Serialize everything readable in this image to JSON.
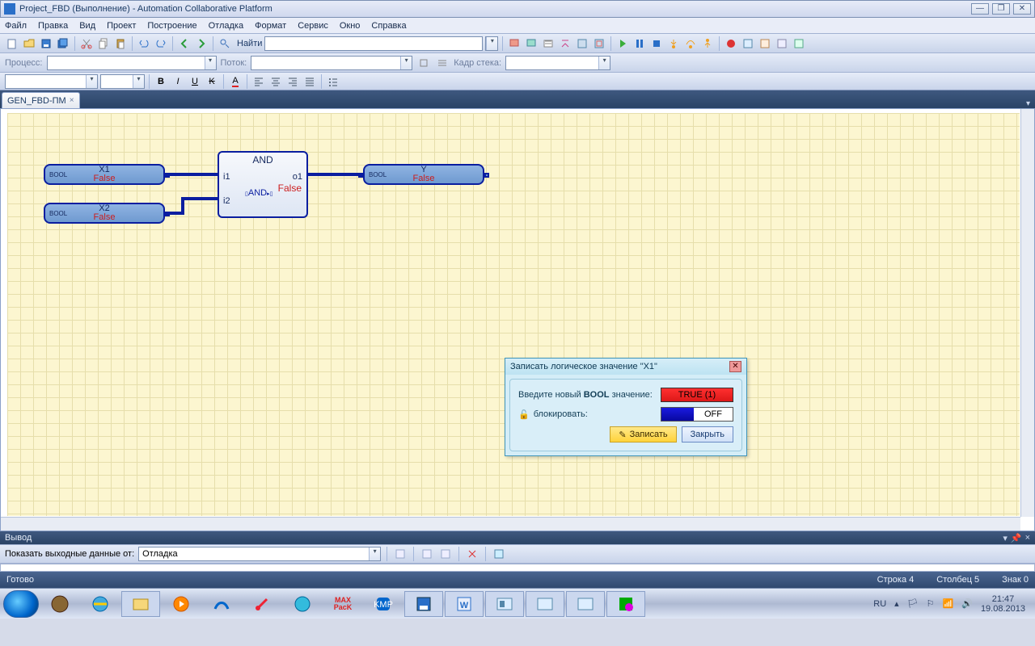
{
  "title": "Project_FBD (Выполнение) - Automation Collaborative Platform",
  "menu": [
    "Файл",
    "Правка",
    "Вид",
    "Проект",
    "Построение",
    "Отладка",
    "Формат",
    "Сервис",
    "Окно",
    "Справка"
  ],
  "find_label": "Найти",
  "process_label": "Процесс:",
  "thread_label": "Поток:",
  "stack_label": "Кадр стека:",
  "tab": "GEN_FBD-ПМ",
  "nodes": {
    "x1": {
      "name": "X1",
      "val": "False",
      "type": "BOOL"
    },
    "x2": {
      "name": "X2",
      "val": "False",
      "type": "BOOL"
    },
    "y": {
      "name": "Y",
      "val": "False",
      "type": "BOOL"
    },
    "and": {
      "title": "AND",
      "i1": "i1",
      "i2": "i2",
      "o1": "o1",
      "val": "False",
      "mini": "AND"
    }
  },
  "dialog": {
    "title": "Записать логическое значение \"X1\"",
    "enter_prefix": "Введите новый ",
    "enter_bold": "BOOL",
    "enter_suffix": " значение:",
    "true_val": "TRUE (1)",
    "lock": "блокировать:",
    "off": "OFF",
    "write": "Записать",
    "close": "Закрыть"
  },
  "output": {
    "header": "Вывод",
    "show": "Показать выходные данные от:",
    "sel": "Отладка"
  },
  "status": {
    "ready": "Готово",
    "line": "Строка 4",
    "col": "Столбец 5",
    "char": "Знак 0"
  },
  "tray": {
    "lang": "RU",
    "time": "21:47",
    "date": "19.08.2013"
  }
}
